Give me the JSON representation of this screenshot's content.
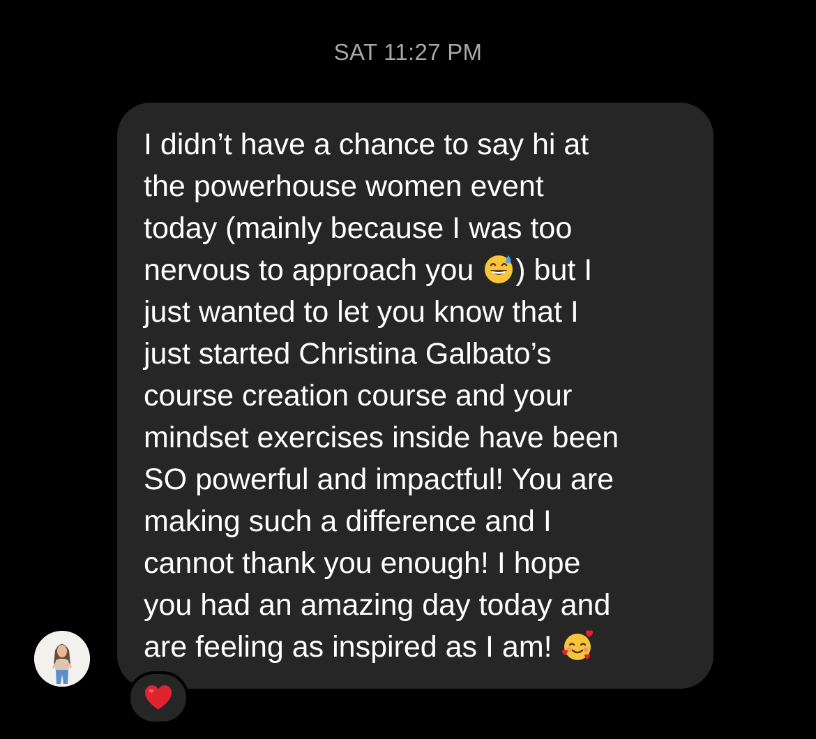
{
  "timestamp": "SAT 11:27 PM",
  "message": {
    "lines": [
      "I didn’t have a chance to say hi at",
      "the powerhouse women event",
      "today (mainly because I was too",
      "nervous to approach you ",
      ") but I",
      "just wanted to let you know that I",
      "just started Christina Galbato’s",
      "course creation course and your",
      "mindset exercises inside have been",
      "SO powerful and impactful! You are",
      "making such a difference and I",
      "cannot thank you enough! I hope",
      "you had an amazing day today and",
      "are feeling as inspired as I am! "
    ],
    "emojis": [
      "grinning-sweat-emoji",
      "smiling-face-with-hearts-emoji"
    ]
  },
  "reaction": {
    "icon": "red-heart-icon"
  },
  "colors": {
    "background": "#000000",
    "bubble": "#262626",
    "timestamp": "#a8a8a8",
    "text": "#ffffff",
    "heart": "#e0242f"
  }
}
